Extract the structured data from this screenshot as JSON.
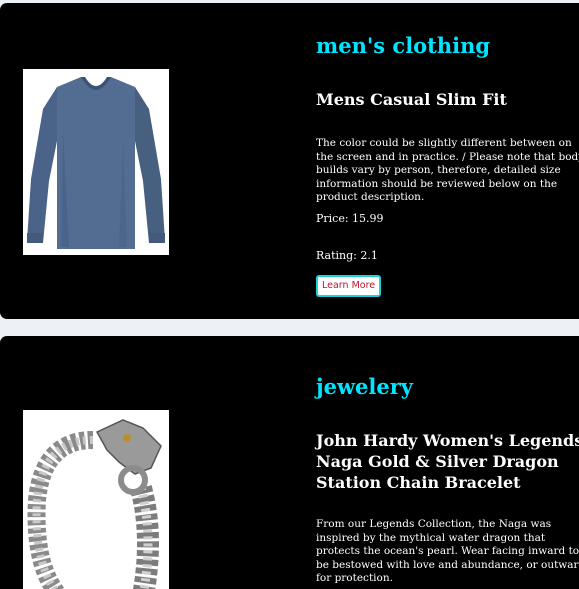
{
  "products": [
    {
      "category": "men's clothing",
      "title": "Mens Casual Slim Fit",
      "description": "The color could be slightly different between on the screen and in practice. / Please note that body builds vary by person, therefore, detailed size information should be reviewed below on the product description.",
      "price": "Price: 15.99",
      "rating": "Rating: 2.1",
      "button_label": "Learn More",
      "image_icon": "long-sleeve-shirt-icon"
    },
    {
      "category": "jewelery",
      "title": "John Hardy Women's Legends Naga Gold & Silver Dragon Station Chain Bracelet",
      "description": "From our Legends Collection, the Naga was inspired by the mythical water dragon that protects the ocean's pearl. Wear facing inward to be bestowed with love and abundance, or outward for protection.",
      "image_icon": "dragon-bracelet-icon"
    }
  ],
  "colors": {
    "card_background": "#000000",
    "category_text": "#00e5ff",
    "body_text": "#ffffff",
    "button_text": "#c0142e",
    "button_border": "#1ecfe0"
  }
}
